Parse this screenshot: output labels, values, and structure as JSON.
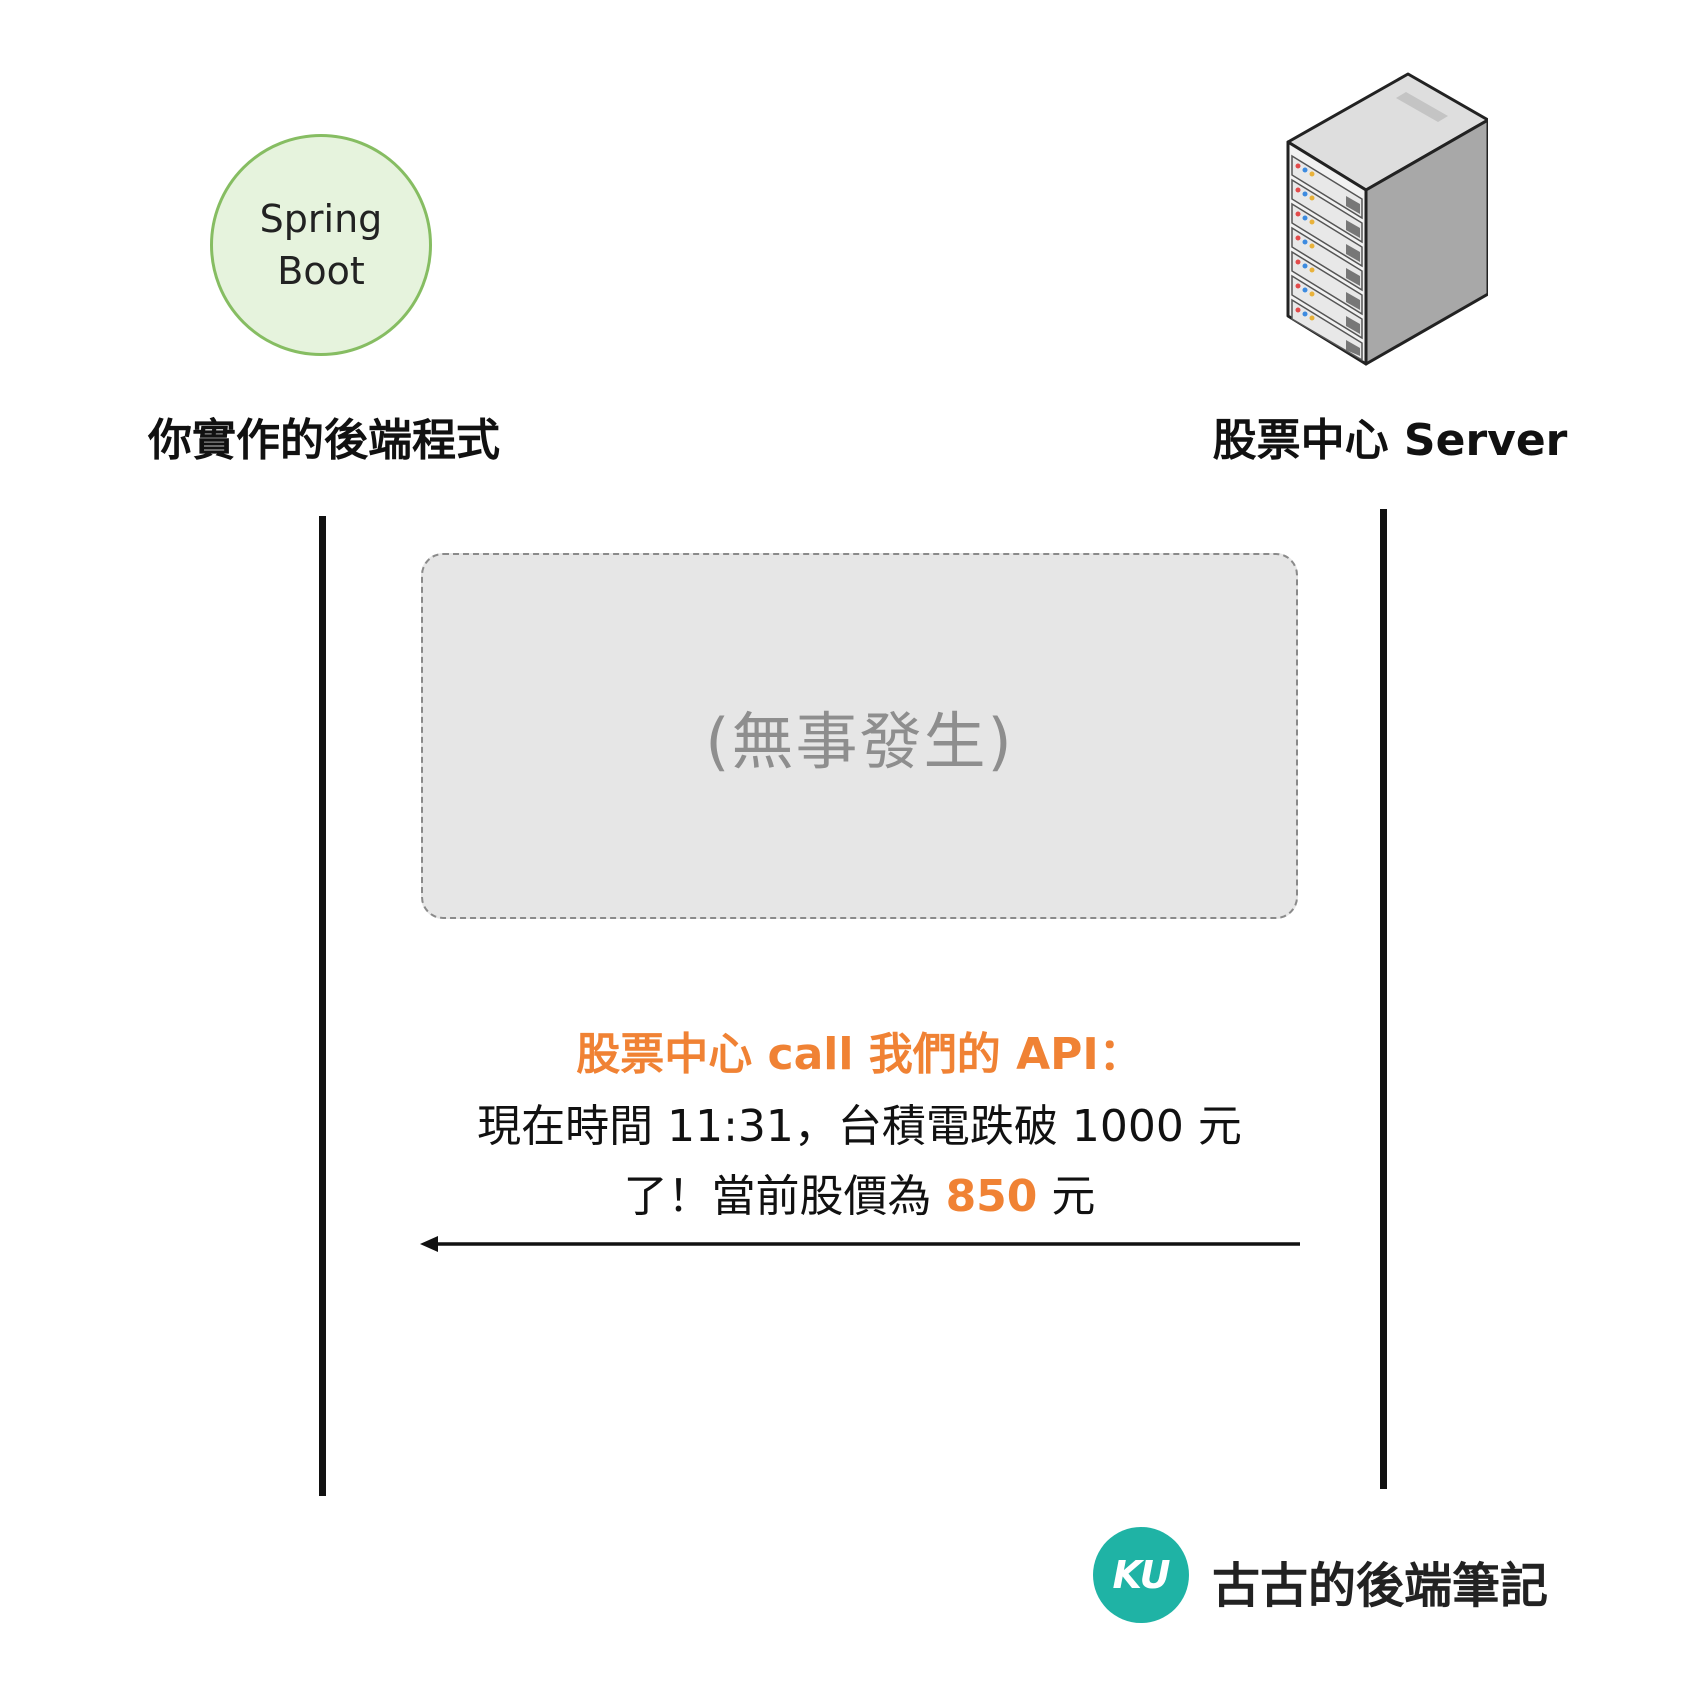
{
  "left_actor": {
    "circle_text_line1": "Spring",
    "circle_text_line2": "Boot",
    "label": "你實作的後端程式",
    "circle_fill": "#e6f3dd",
    "circle_stroke": "#86bd62"
  },
  "right_actor": {
    "icon": "server-rack-icon",
    "label": "股票中心 Server"
  },
  "idle_box": {
    "text": "(無事發生)"
  },
  "message": {
    "title": "股票中心 call 我們的 API：",
    "line1": "現在時間 11:31，台積電跌破 1000 元",
    "line2_prefix": "了！當前股價為 ",
    "price": "850",
    "line2_suffix": " 元",
    "direction": "server-to-backend",
    "accent_color": "#f08234"
  },
  "brand": {
    "logo_text": "KU",
    "name": "古古的後端筆記",
    "logo_color": "#1fb3a5"
  }
}
